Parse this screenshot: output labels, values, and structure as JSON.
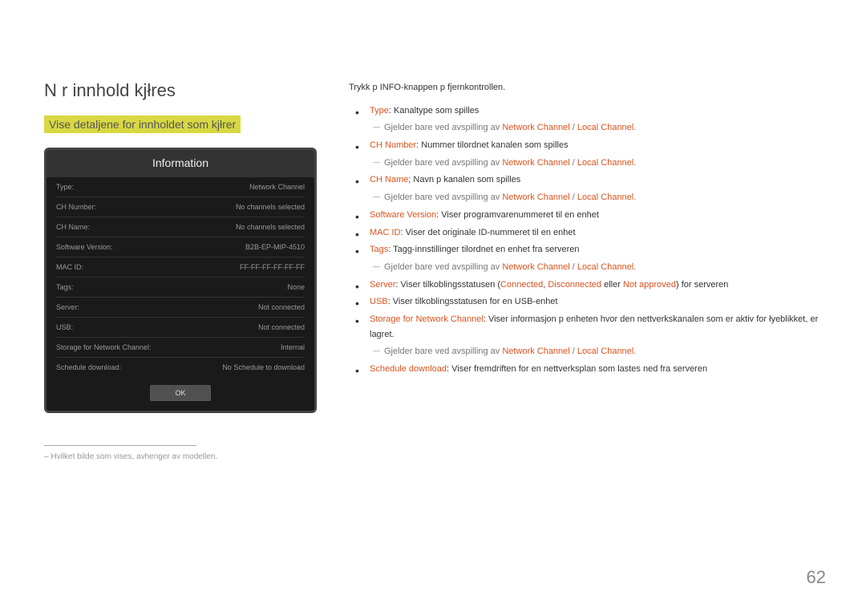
{
  "heading": "N r innhold kjłres",
  "subheading": "Vise detaljene for innholdet som kjłrer",
  "info_panel": {
    "title": "Information",
    "rows": [
      {
        "label": "Type:",
        "value": "Network Channel"
      },
      {
        "label": "CH Number:",
        "value": "No channels selected"
      },
      {
        "label": "CH Name:",
        "value": "No channels selected"
      },
      {
        "label": "Software Version:",
        "value": "B2B-EP-MIP-4510"
      },
      {
        "label": "MAC ID:",
        "value": "FF-FF-FF-FF-FF-FF"
      },
      {
        "label": "Tags:",
        "value": "None"
      },
      {
        "label": "Server:",
        "value": "Not connected"
      },
      {
        "label": "USB:",
        "value": "Not connected"
      },
      {
        "label": "Storage for Network Channel:",
        "value": "Internal"
      },
      {
        "label": "Schedule download:",
        "value": "No Schedule to download"
      }
    ],
    "ok": "OK"
  },
  "footnote": "Hvilket bilde som vises, avhenger av modellen.",
  "intro": "Trykk p  INFO-knappen p  fjernkontrollen.",
  "items": {
    "type_term": "Type",
    "type_desc": ": Kanaltype som spilles",
    "gjeld": "Gjelder bare ved avspilling av ",
    "nc": "Network Channel",
    "lc": "Local Channel",
    "chnum_term": "CH Number",
    "chnum_desc": ": Nummer tilordnet kanalen som spilles",
    "chname_term": "CH Name",
    "chname_desc": "; Navn p  kanalen som spilles",
    "sw_term": "Software Version",
    "sw_desc": ": Viser programvarenummeret til en enhet",
    "mac_term": "MAC ID",
    "mac_desc": ": Viser det originale ID-nummeret til en enhet",
    "tags_term": "Tags",
    "tags_desc": ": Tagg-innstillinger tilordnet en enhet fra serveren",
    "server_term": "Server",
    "server_pre": ": Viser tilkoblingsstatusen (",
    "connected": "Connected",
    "disconnected": "Disconnected",
    "eller": " eller ",
    "notapproved": "Not approved",
    "server_post": ") for serveren",
    "usb_term": "USB",
    "usb_desc": ": Viser tilkoblingsstatusen for en USB-enhet",
    "storage_term": "Storage for Network Channel",
    "storage_desc": ": Viser informasjon p  enheten hvor den nettverkskanalen som er aktiv for łyeblikket, er lagret.",
    "sched_term": "Schedule download",
    "sched_desc": ": Viser fremdriften for en nettverksplan som lastes ned fra serveren",
    "slash": " / ",
    "comma": ", ",
    "dot": "."
  },
  "page_number": "62"
}
